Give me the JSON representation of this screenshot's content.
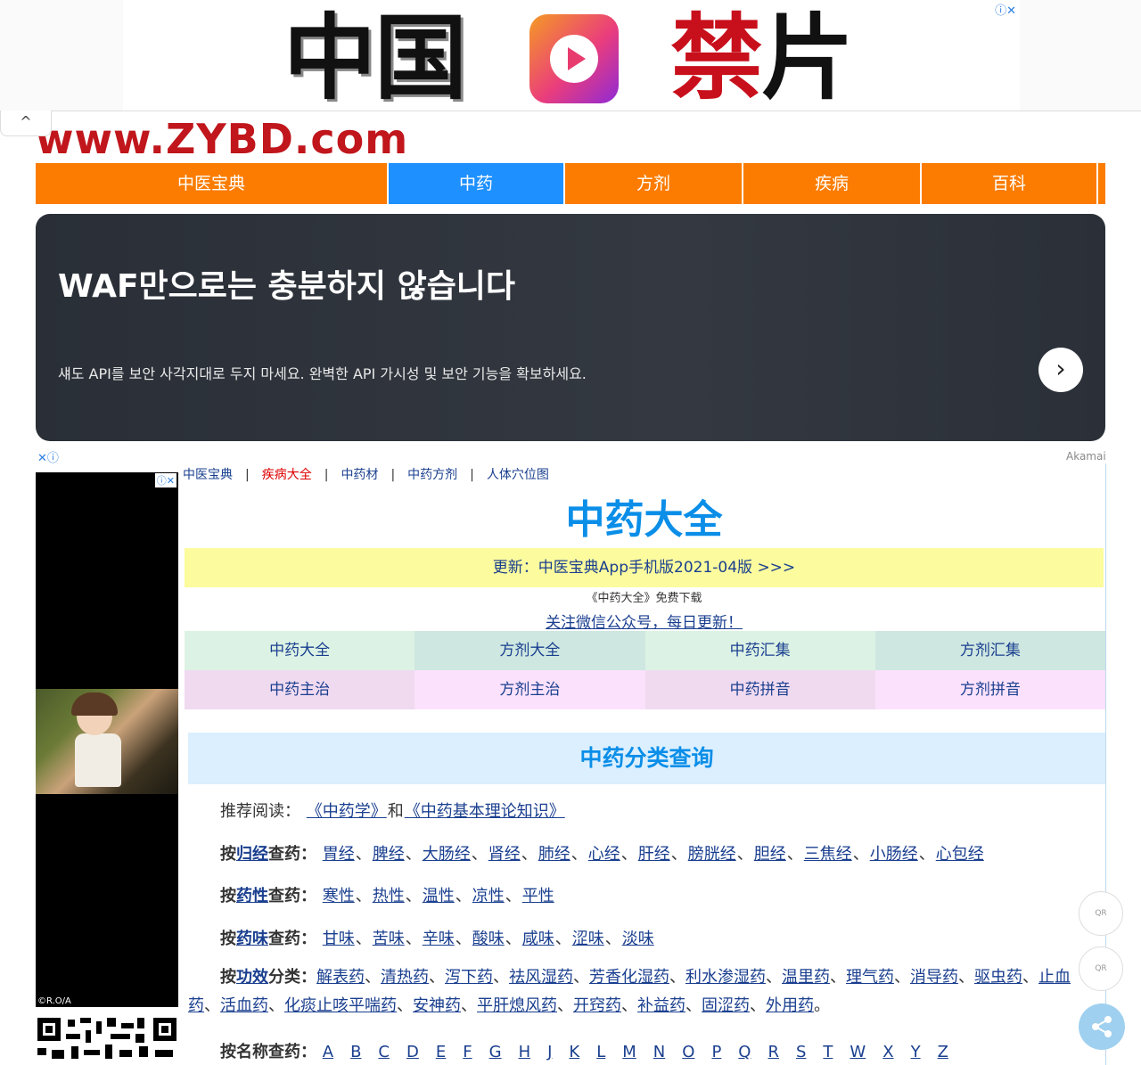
{
  "top_ad": {
    "word_left": "中国",
    "word_right_red": "禁",
    "word_right_black": "片",
    "badge": "ⓘ✕",
    "icon": "app-play-icon"
  },
  "collapse_icon": "^",
  "logo": {
    "text": "www.ZYBD.com"
  },
  "nav": {
    "items": [
      {
        "label": "中医宝典",
        "active": false
      },
      {
        "label": "中药",
        "active": true
      },
      {
        "label": "方剂",
        "active": false
      },
      {
        "label": "疾病",
        "active": false
      },
      {
        "label": "百科",
        "active": false
      }
    ]
  },
  "banner_ad": {
    "title": "WAF만으로는 충분하지 않습니다",
    "subtitle": "섀도 API를 보안 사각지대로 두지 마세요. 완벽한 API 가시성 및 보안 기능을 확보하세요.",
    "button": "›",
    "ad_mark": "✕ⓘ",
    "sponsor": "Akamai"
  },
  "side_ad": {
    "badge": "ⓘ✕",
    "copyright": "©R.O/A"
  },
  "breadcrumb": {
    "items": [
      "中医宝典",
      "疾病大全",
      "中药材",
      "中药方剂",
      "人体穴位图"
    ],
    "sep": "|"
  },
  "page_title": "中药大全",
  "update_bar": "更新：中医宝典App手机版2021-04版 >>>",
  "download_text": "《中药大全》免费下载",
  "wechat_text": "关注微信公众号，每日更新！",
  "grid": [
    "中药大全",
    "方剂大全",
    "中药汇集",
    "方剂汇集",
    "中药主治",
    "方剂主治",
    "中药拼音",
    "方剂拼音"
  ],
  "category_head": "中药分类查询",
  "recommend": {
    "label": "推荐阅读：",
    "link1": "《中药学》",
    "and": "和",
    "link2": "《中药基本理论知识》"
  },
  "by_meridian": {
    "prefix": "按",
    "key": "归经",
    "suffix": "查药：",
    "items": [
      "胃经",
      "脾经",
      "大肠经",
      "肾经",
      "肺经",
      "心经",
      "肝经",
      "膀胱经",
      "胆经",
      "三焦经",
      "小肠经",
      "心包经"
    ]
  },
  "by_nature": {
    "prefix": "按",
    "key": "药性",
    "suffix": "查药：",
    "items": [
      "寒性",
      "热性",
      "温性",
      "凉性",
      "平性"
    ]
  },
  "by_flavor": {
    "prefix": "按",
    "key": "药味",
    "suffix": "查药：",
    "items": [
      "甘味",
      "苦味",
      "辛味",
      "酸味",
      "咸味",
      "涩味",
      "淡味"
    ]
  },
  "by_effect": {
    "prefix": "按",
    "key": "功效",
    "suffix": "分类：",
    "items": [
      "解表药",
      "清热药",
      "泻下药",
      "祛风湿药",
      "芳香化湿药",
      "利水渗湿药",
      "温里药",
      "理气药",
      "消导药",
      "驱虫药",
      "止血药",
      "活血药",
      "化痰止咳平喘药",
      "安神药",
      "平肝熄风药",
      "开窍药",
      "补益药",
      "固涩药",
      "外用药"
    ],
    "end": "。"
  },
  "by_name": {
    "label": "按名称查药：",
    "letters": [
      "A",
      "B",
      "C",
      "D",
      "E",
      "F",
      "G",
      "H",
      "J",
      "K",
      "L",
      "M",
      "N",
      "O",
      "P",
      "Q",
      "R",
      "S",
      "T",
      "W",
      "X",
      "Y",
      "Z"
    ]
  },
  "float_widgets": {
    "qr1": "QR",
    "qr2": "QR",
    "share_icon": "share-icon"
  }
}
